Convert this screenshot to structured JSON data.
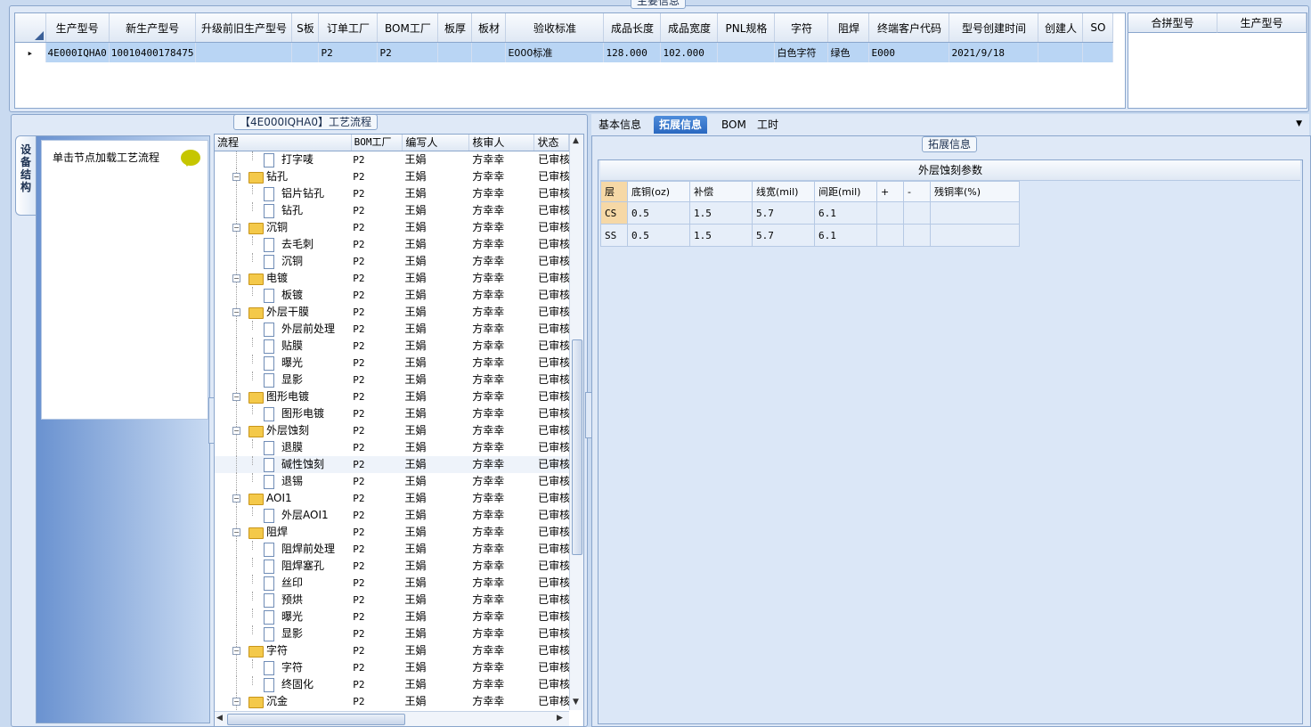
{
  "main_info_caption": "主要信息",
  "top_columns": [
    "生产型号",
    "新生产型号",
    "升级前旧生产型号",
    "S板",
    "订单工厂",
    "BOM工厂",
    "板厚",
    "板材",
    "验收标准",
    "成品长度",
    "成品宽度",
    "PNL规格",
    "字符",
    "阻焊",
    "终端客户代码",
    "型号创建时间",
    "创建人",
    "SO"
  ],
  "top_row": [
    "4E000IQHA0",
    "10010400178475",
    "",
    "",
    "P2",
    "P2",
    "",
    "",
    "E000标准",
    "128.000",
    "102.000",
    "",
    "白色字符",
    "绿色",
    "E000",
    "2021/9/18",
    "",
    ""
  ],
  "right_grid_columns": [
    "合拼型号",
    "生产型号"
  ],
  "device_tab_label": "设备结构",
  "left_button_label": "单击节点加载工艺流程",
  "process_caption": "【4E000IQHA0】工艺流程",
  "tree_columns": [
    "流程",
    "BOM工厂",
    "编写人",
    "核审人",
    "状态"
  ],
  "tree_rows": [
    {
      "label": "打字唛",
      "level": 1,
      "type": "doc",
      "bom": "P2",
      "writer": "王娟",
      "reviewer": "方幸幸",
      "status": "已审核"
    },
    {
      "label": "钻孔",
      "level": 0,
      "type": "folder",
      "bom": "P2",
      "writer": "王娟",
      "reviewer": "方幸幸",
      "status": "已审核"
    },
    {
      "label": "铝片钻孔",
      "level": 1,
      "type": "doc",
      "bom": "P2",
      "writer": "王娟",
      "reviewer": "方幸幸",
      "status": "已审核"
    },
    {
      "label": "钻孔",
      "level": 1,
      "type": "doc",
      "bom": "P2",
      "writer": "王娟",
      "reviewer": "方幸幸",
      "status": "已审核"
    },
    {
      "label": "沉铜",
      "level": 0,
      "type": "folder",
      "bom": "P2",
      "writer": "王娟",
      "reviewer": "方幸幸",
      "status": "已审核"
    },
    {
      "label": "去毛刺",
      "level": 1,
      "type": "doc",
      "bom": "P2",
      "writer": "王娟",
      "reviewer": "方幸幸",
      "status": "已审核"
    },
    {
      "label": "沉铜",
      "level": 1,
      "type": "doc",
      "bom": "P2",
      "writer": "王娟",
      "reviewer": "方幸幸",
      "status": "已审核"
    },
    {
      "label": "电镀",
      "level": 0,
      "type": "folder",
      "bom": "P2",
      "writer": "王娟",
      "reviewer": "方幸幸",
      "status": "已审核"
    },
    {
      "label": "板镀",
      "level": 1,
      "type": "doc",
      "bom": "P2",
      "writer": "王娟",
      "reviewer": "方幸幸",
      "status": "已审核"
    },
    {
      "label": "外层干膜",
      "level": 0,
      "type": "folder",
      "bom": "P2",
      "writer": "王娟",
      "reviewer": "方幸幸",
      "status": "已审核"
    },
    {
      "label": "外层前处理",
      "level": 1,
      "type": "doc",
      "bom": "P2",
      "writer": "王娟",
      "reviewer": "方幸幸",
      "status": "已审核"
    },
    {
      "label": "贴膜",
      "level": 1,
      "type": "doc",
      "bom": "P2",
      "writer": "王娟",
      "reviewer": "方幸幸",
      "status": "已审核"
    },
    {
      "label": "曝光",
      "level": 1,
      "type": "doc",
      "bom": "P2",
      "writer": "王娟",
      "reviewer": "方幸幸",
      "status": "已审核"
    },
    {
      "label": "显影",
      "level": 1,
      "type": "doc",
      "bom": "P2",
      "writer": "王娟",
      "reviewer": "方幸幸",
      "status": "已审核"
    },
    {
      "label": "图形电镀",
      "level": 0,
      "type": "folder",
      "bom": "P2",
      "writer": "王娟",
      "reviewer": "方幸幸",
      "status": "已审核"
    },
    {
      "label": "图形电镀",
      "level": 1,
      "type": "doc",
      "bom": "P2",
      "writer": "王娟",
      "reviewer": "方幸幸",
      "status": "已审核"
    },
    {
      "label": "外层蚀刻",
      "level": 0,
      "type": "folder",
      "bom": "P2",
      "writer": "王娟",
      "reviewer": "方幸幸",
      "status": "已审核"
    },
    {
      "label": "退膜",
      "level": 1,
      "type": "doc",
      "bom": "P2",
      "writer": "王娟",
      "reviewer": "方幸幸",
      "status": "已审核"
    },
    {
      "label": "碱性蚀刻",
      "level": 1,
      "type": "doc",
      "bom": "P2",
      "writer": "王娟",
      "reviewer": "方幸幸",
      "status": "已审核",
      "selected": true
    },
    {
      "label": "退锡",
      "level": 1,
      "type": "doc",
      "bom": "P2",
      "writer": "王娟",
      "reviewer": "方幸幸",
      "status": "已审核"
    },
    {
      "label": "AOI1",
      "level": 0,
      "type": "folder",
      "bom": "P2",
      "writer": "王娟",
      "reviewer": "方幸幸",
      "status": "已审核"
    },
    {
      "label": "外层AOI1",
      "level": 1,
      "type": "doc",
      "bom": "P2",
      "writer": "王娟",
      "reviewer": "方幸幸",
      "status": "已审核"
    },
    {
      "label": "阻焊",
      "level": 0,
      "type": "folder",
      "bom": "P2",
      "writer": "王娟",
      "reviewer": "方幸幸",
      "status": "已审核"
    },
    {
      "label": "阻焊前处理",
      "level": 1,
      "type": "doc",
      "bom": "P2",
      "writer": "王娟",
      "reviewer": "方幸幸",
      "status": "已审核"
    },
    {
      "label": "阻焊塞孔",
      "level": 1,
      "type": "doc",
      "bom": "P2",
      "writer": "王娟",
      "reviewer": "方幸幸",
      "status": "已审核"
    },
    {
      "label": "丝印",
      "level": 1,
      "type": "doc",
      "bom": "P2",
      "writer": "王娟",
      "reviewer": "方幸幸",
      "status": "已审核"
    },
    {
      "label": "预烘",
      "level": 1,
      "type": "doc",
      "bom": "P2",
      "writer": "王娟",
      "reviewer": "方幸幸",
      "status": "已审核"
    },
    {
      "label": "曝光",
      "level": 1,
      "type": "doc",
      "bom": "P2",
      "writer": "王娟",
      "reviewer": "方幸幸",
      "status": "已审核"
    },
    {
      "label": "显影",
      "level": 1,
      "type": "doc",
      "bom": "P2",
      "writer": "王娟",
      "reviewer": "方幸幸",
      "status": "已审核"
    },
    {
      "label": "字符",
      "level": 0,
      "type": "folder",
      "bom": "P2",
      "writer": "王娟",
      "reviewer": "方幸幸",
      "status": "已审核"
    },
    {
      "label": "字符",
      "level": 1,
      "type": "doc",
      "bom": "P2",
      "writer": "王娟",
      "reviewer": "方幸幸",
      "status": "已审核"
    },
    {
      "label": "终固化",
      "level": 1,
      "type": "doc",
      "bom": "P2",
      "writer": "王娟",
      "reviewer": "方幸幸",
      "status": "已审核"
    },
    {
      "label": "沉金",
      "level": 0,
      "type": "folder",
      "bom": "P2",
      "writer": "王娟",
      "reviewer": "方幸幸",
      "status": "已审核"
    }
  ],
  "right_tabs": [
    "基本信息",
    "拓展信息",
    "BOM",
    "工时"
  ],
  "active_tab": 1,
  "ext_caption": "拓展信息",
  "param_title": "外层蚀刻参数",
  "param_columns": [
    "层",
    "底铜(oz)",
    "补偿",
    "线宽(mil)",
    "间距(mil)",
    "+",
    "-",
    "残铜率(%)"
  ],
  "param_rows": [
    [
      "CS",
      "0.5",
      "1.5",
      "5.7",
      "6.1",
      "",
      "",
      ""
    ],
    [
      "SS",
      "0.5",
      "1.5",
      "5.7",
      "6.1",
      "",
      "",
      ""
    ]
  ]
}
